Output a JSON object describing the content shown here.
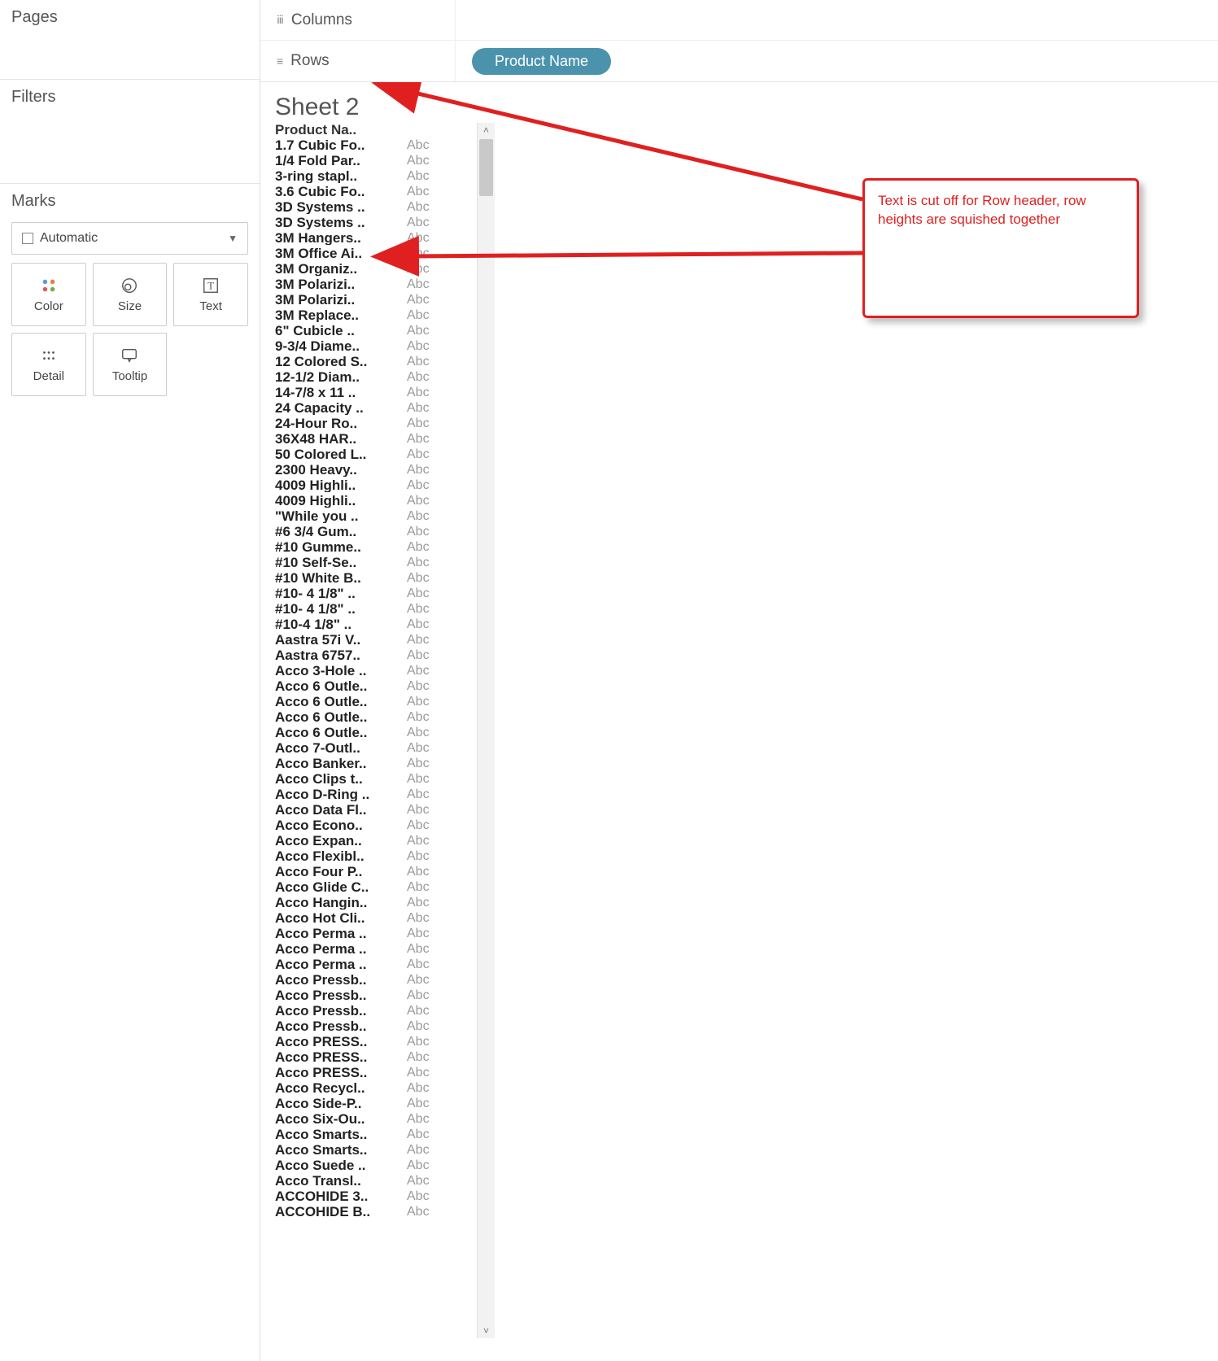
{
  "left": {
    "pages_label": "Pages",
    "filters_label": "Filters",
    "marks_label": "Marks",
    "marks_select": "Automatic",
    "buttons": {
      "color": "Color",
      "size": "Size",
      "text": "Text",
      "detail": "Detail",
      "tooltip": "Tooltip"
    }
  },
  "top": {
    "columns_label": "Columns",
    "rows_label": "Rows",
    "row_pill": "Product Name"
  },
  "viz": {
    "sheet_title": "Sheet 2",
    "header": "Product Na..",
    "abc": "Abc",
    "rows": [
      "1.7 Cubic Fo..",
      "1/4 Fold Par..",
      "3-ring stapl..",
      "3.6 Cubic Fo..",
      "3D Systems ..",
      "3D Systems ..",
      "3M Hangers..",
      "3M Office Ai..",
      "3M Organiz..",
      "3M Polarizi..",
      "3M Polarizi..",
      "3M Replace..",
      "6\" Cubicle ..",
      "9-3/4 Diame..",
      "12 Colored S..",
      "12-1/2 Diam..",
      "14-7/8 x 11 ..",
      "24 Capacity ..",
      "24-Hour Ro..",
      "36X48 HAR..",
      "50 Colored L..",
      "2300 Heavy..",
      "4009 Highli..",
      "4009 Highli..",
      "\"While you ..",
      "#6 3/4 Gum..",
      "#10 Gumme..",
      "#10 Self-Se..",
      "#10 White B..",
      "#10- 4 1/8\" ..",
      "#10- 4 1/8\" ..",
      "#10-4 1/8\" ..",
      "Aastra 57i V..",
      "Aastra 6757..",
      "Acco 3-Hole ..",
      "Acco 6 Outle..",
      "Acco 6 Outle..",
      "Acco 6 Outle..",
      "Acco 6 Outle..",
      "Acco 7-Outl..",
      "Acco Banker..",
      "Acco Clips t..",
      "Acco D-Ring ..",
      "Acco Data Fl..",
      "Acco Econo..",
      "Acco Expan..",
      "Acco Flexibl..",
      "Acco Four P..",
      "Acco Glide C..",
      "Acco Hangin..",
      "Acco Hot Cli..",
      "Acco Perma ..",
      "Acco Perma ..",
      "Acco Perma ..",
      "Acco Pressb..",
      "Acco Pressb..",
      "Acco Pressb..",
      "Acco Pressb..",
      "Acco PRESS..",
      "Acco PRESS..",
      "Acco PRESS..",
      "Acco Recycl..",
      "Acco Side-P..",
      "Acco Six-Ou..",
      "Acco Smarts..",
      "Acco Smarts..",
      "Acco Suede ..",
      "Acco Transl..",
      "ACCOHIDE 3..",
      "ACCOHIDE B.."
    ]
  },
  "annotation": {
    "text": "Text is cut off for Row header, row heights are squished together"
  }
}
